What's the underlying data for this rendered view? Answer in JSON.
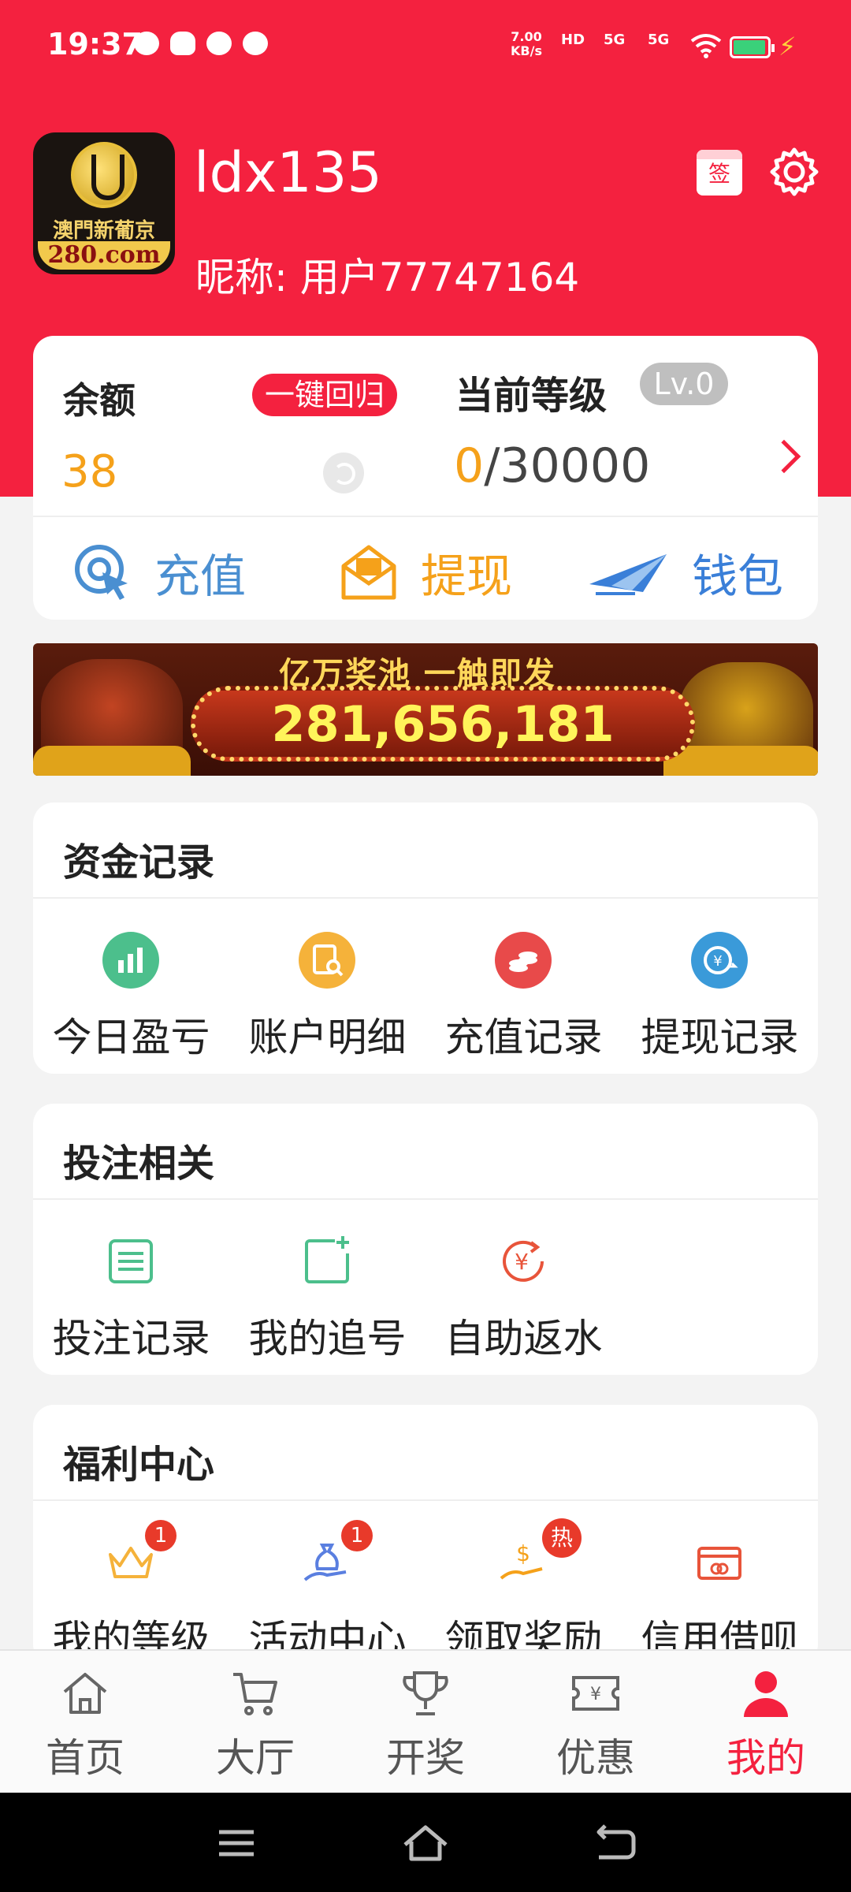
{
  "status_bar": {
    "time": "19:37",
    "net_speed_value": "7.00",
    "net_speed_unit": "KB/s",
    "hd_label": "HD",
    "sim1": "5G",
    "sim2": "5G"
  },
  "profile": {
    "logo_text": "澳門新葡京",
    "logo_url": "280.com",
    "username": "ldx135",
    "nickname": "昵称: 用户77747164",
    "sign_icon_text": "签"
  },
  "balance": {
    "label": "余额",
    "one_click_label": "一键回归",
    "value": "38",
    "level_label": "当前等级",
    "level_badge": "Lv.0",
    "level_current": "0",
    "level_total": "/30000"
  },
  "actions": [
    {
      "label": "充值"
    },
    {
      "label": "提现"
    },
    {
      "label": "钱包"
    }
  ],
  "banner": {
    "slogan": "亿万奖池 一触即发",
    "jackpot": "281,656,181"
  },
  "funds_section": {
    "title": "资金记录",
    "items": [
      {
        "label": "今日盈亏",
        "color": "#4cbf8c"
      },
      {
        "label": "账户明细",
        "color": "#f5b23a"
      },
      {
        "label": "充值记录",
        "color": "#e84a4a"
      },
      {
        "label": "提现记录",
        "color": "#3a9ad9"
      }
    ]
  },
  "bet_section": {
    "title": "投注相关",
    "items": [
      {
        "label": "投注记录"
      },
      {
        "label": "我的追号"
      },
      {
        "label": "自助返水"
      }
    ]
  },
  "welfare_section": {
    "title": "福利中心",
    "items": [
      {
        "label": "我的等级",
        "badge": "1"
      },
      {
        "label": "活动中心",
        "badge": "1"
      },
      {
        "label": "领取奖励",
        "badge": "热"
      },
      {
        "label": "信用借呗"
      }
    ]
  },
  "tabs": [
    {
      "label": "首页"
    },
    {
      "label": "大厅"
    },
    {
      "label": "开奖"
    },
    {
      "label": "优惠"
    },
    {
      "label": "我的"
    }
  ],
  "colors": {
    "brand_red": "#f4213f",
    "accent_orange": "#f5a11a",
    "accent_blue": "#4a8fd1"
  }
}
